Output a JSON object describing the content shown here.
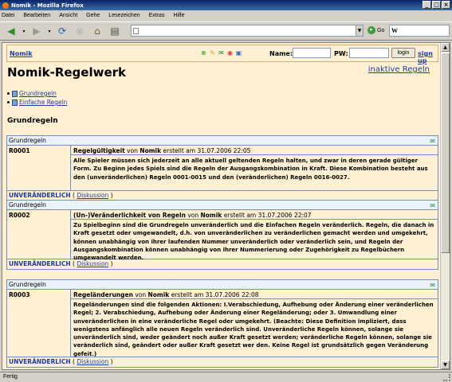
{
  "window": {
    "title": "Nomik - Mozilla Firefox"
  },
  "menu": [
    "Datei",
    "Bearbeiten",
    "Ansicht",
    "Gehe",
    "Lesezeichen",
    "Extras",
    "Hilfe"
  ],
  "toolbar": {
    "go_label": "Go",
    "search_value": "W"
  },
  "header": {
    "brand": "Nomik",
    "name_label": "Name:",
    "pw_label": "PW:",
    "login_label": "login",
    "signup_label": "sign up"
  },
  "page": {
    "title": "Nomik-Regelwerk",
    "inactive_link": "inaktive Regeln",
    "nav": [
      "Grundregeln",
      "Einfache Regeln"
    ],
    "section_title": "Grundregeln"
  },
  "rules": [
    {
      "category": "Grundregeln",
      "id": "R0001",
      "name": "Regelgültigkeit",
      "by": "von",
      "author": "Nomik",
      "created": "erstellt am 31.07.2006 22:05",
      "text": "Alle Spieler müssen sich jederzeit an alle aktuell geltenden Regeln halten, und zwar in deren gerade gültiger Form. Zu Beginn jedes Spiels sind die Regeln der Ausgangskombination in Kraft. Diese Kombination besteht aus den (unveränderlichen) Regeln 0001-0015 und den (veränderlichen) Regeln 0016-0027.",
      "status": "UNVERÄNDERLICH",
      "discussion": "Diskussion"
    },
    {
      "category": "Grundregeln",
      "id": "R0002",
      "name": "(Un-)Veränderlichkeit von Regeln",
      "by": "von",
      "author": "Nomik",
      "created": "erstellt am 31.07.2006 22:07",
      "text": "Zu Spielbeginn sind die Grundregeln unveränderlich und die Einfachen Regeln veränderlich. Regeln, die danach in Kraft gesetzt oder umgewandelt, d.h. von unveränderlichen zu veränderlichen gemacht werden und umgekehrt, können unabhängig von ihrer laufenden Nummer unveränderlich oder veränderlich sein, und Regeln der Ausgangskombination können unabhängig von ihrer Nummerierung oder Zugehörigkeit zu Regelbüchern umgewandelt werden.",
      "status": "UNVERÄNDERLICH",
      "discussion": "Diskussion"
    },
    {
      "category": "Grundregeln",
      "id": "R0003",
      "name": "Regeländerungen",
      "by": "von",
      "author": "Nomik",
      "created": "erstellt am 31.07.2006 22:08",
      "text": "Regeländerungen sind die folgenden Aktionen: I.Verabschiedung, Aufhebung oder Änderung einer veränderlichen Regel; 2. Verabschiedung, Aufhebung oder Änderung einer Regeländerung; oder 3. Umwandlung einer unveränderlichen in eine veränderliche Regel oder umgekehrt. (Beachte: Diese Definition impliziert, dass wenigstens anfänglich alle neuen Regeln veränderlich sind. Unveränderliche Regeln können, solange sie unveränderlich sind, weder geändert noch außer Kraft gesetzt werden; veränderliche Regeln können, solange sie veränderlich sind, geändert oder außer Kraft gesetzt wer den. Keine Regel ist grundsätzlich gegen Veränderung gefeit.)",
      "status": "UNVERÄNDERLICH",
      "discussion": "Diskussion"
    }
  ],
  "statusbar": {
    "text": "Fertig"
  }
}
